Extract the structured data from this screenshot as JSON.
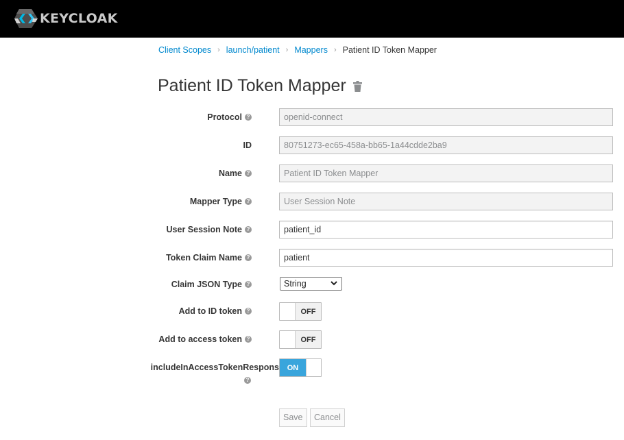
{
  "header": {
    "brand": "KEYCLOAK"
  },
  "breadcrumb": {
    "items": [
      {
        "label": "Client Scopes"
      },
      {
        "label": "launch/patient"
      },
      {
        "label": "Mappers"
      }
    ],
    "current": "Patient ID Token Mapper",
    "separator": "›"
  },
  "page": {
    "title": "Patient ID Token Mapper"
  },
  "form": {
    "protocol": {
      "label": "Protocol",
      "value": "openid-connect"
    },
    "id": {
      "label": "ID",
      "value": "80751273-ec65-458a-bb65-1a44cdde2ba9"
    },
    "name": {
      "label": "Name",
      "value": "Patient ID Token Mapper"
    },
    "mapper_type": {
      "label": "Mapper Type",
      "value": "User Session Note"
    },
    "user_session_note": {
      "label": "User Session Note",
      "value": "patient_id"
    },
    "token_claim_name": {
      "label": "Token Claim Name",
      "value": "patient"
    },
    "claim_json_type": {
      "label": "Claim JSON Type",
      "selected": "String"
    },
    "add_to_id_token": {
      "label": "Add to ID token",
      "state": "OFF"
    },
    "add_to_access_token": {
      "label": "Add to access token",
      "state": "OFF"
    },
    "include_in_access_token_response": {
      "label": "includeInAccessTokenRespons",
      "state": "ON"
    }
  },
  "help_glyph": "?",
  "actions": {
    "save": "Save",
    "cancel": "Cancel"
  },
  "colors": {
    "link": "#0088ce",
    "toggle_on": "#39a5dc",
    "header_bg": "#000000"
  }
}
